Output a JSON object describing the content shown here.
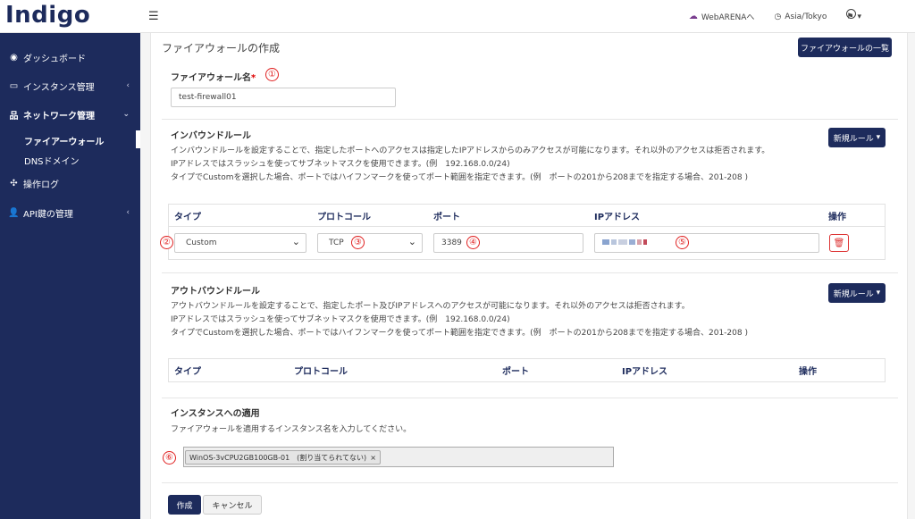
{
  "header": {
    "logo": "Indigo",
    "menu_icon": "hamburger-icon",
    "webarena_label": "WebARENAへ",
    "timezone": "Asia/Tokyo"
  },
  "sidebar": {
    "items": [
      {
        "label": "ダッシュボード",
        "icon": "tachometer-icon"
      },
      {
        "label": "インスタンス管理",
        "icon": "monitor-icon"
      },
      {
        "label": "ネットワーク管理",
        "icon": "sitemap-icon"
      },
      {
        "label": "操作ログ",
        "icon": "crosshair-icon"
      },
      {
        "label": "API鍵の管理",
        "icon": "user-icon"
      }
    ],
    "subitems": [
      {
        "label": "ファイアーウォール"
      },
      {
        "label": "DNSドメイン"
      }
    ]
  },
  "page": {
    "title": "ファイアウォールの作成",
    "list_button": "ファイアウォールの一覧"
  },
  "firewall_name": {
    "label": "ファイアウォール名",
    "required_mark": "*",
    "value": "test-firewall01",
    "marker": "①"
  },
  "inbound": {
    "heading": "インバウンドルール",
    "new_rule_button": "新規ルール",
    "desc1": "インバウンドルールを設定することで、指定したポートへのアクセスは指定したIPアドレスからのみアクセスが可能になります。それ以外のアクセスは拒否されます。",
    "desc2": "IPアドレスではスラッシュを使ってサブネットマスクを使用できます。(例　192.168.0.0/24)",
    "desc3": "タイプでCustomを選択した場合、ポートではハイフンマークを使ってポート範囲を指定できます。(例　ポートの201から208までを指定する場合、201-208 )",
    "columns": {
      "type": "タイプ",
      "protocol": "プロトコール",
      "port": "ポート",
      "ip": "IPアドレス",
      "action": "操作"
    },
    "row": {
      "type": "Custom",
      "protocol": "TCP",
      "port": "3389"
    },
    "markers": {
      "type": "②",
      "protocol": "③",
      "port": "④",
      "ip": "⑤"
    }
  },
  "outbound": {
    "heading": "アウトバウンドルール",
    "new_rule_button": "新規ルール",
    "desc1": "アウトバウンドルールを設定することで、指定したポート及びIPアドレスへのアクセスが可能になります。それ以外のアクセスは拒否されます。",
    "desc2": "IPアドレスではスラッシュを使ってサブネットマスクを使用できます。(例　192.168.0.0/24)",
    "desc3": "タイプでCustomを選択した場合、ポートではハイフンマークを使ってポート範囲を指定できます。(例　ポートの201から208までを指定する場合、201-208 )",
    "columns": {
      "type": "タイプ",
      "protocol": "プロトコール",
      "port": "ポート",
      "ip": "IPアドレス",
      "action": "操作"
    }
  },
  "apply": {
    "heading": "インスタンスへの適用",
    "desc": "ファイアウォールを適用するインスタンス名を入力してください。",
    "tag": "WinOS-3vCPU2GB100GB-01　(割り当てられてない)",
    "tag_remove": "×",
    "marker": "⑥"
  },
  "footer": {
    "create": "作成",
    "cancel": "キャンセル"
  },
  "colors": {
    "brand": "#1d2b5c",
    "marker": "#e02020",
    "danger": "#dd3333"
  }
}
